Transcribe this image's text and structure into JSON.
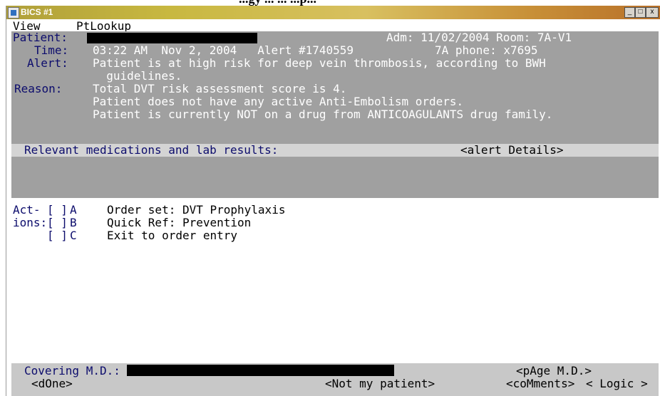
{
  "caption_fragment": "...gy ... ... ...p...",
  "window": {
    "title": "BICS #1",
    "min": "_",
    "restore": "□",
    "close": "x"
  },
  "menu": {
    "view": "View",
    "ptlookup": "PtLookup"
  },
  "patient": {
    "label": "Patient:",
    "adm": "Adm: 11/02/2004 Room: 7A-V1",
    "time_label": "Time:",
    "time_value": "03:22 AM  Nov 2, 2004   Alert #1740559",
    "phone": "7A phone: x7695"
  },
  "alert": {
    "label": "Alert:",
    "line1": "Patient is at high risk for deep vein thrombosis, according to BWH",
    "line2": "  guidelines."
  },
  "reason": {
    "label": "Reason:",
    "lines": [
      "Total DVT risk assessment score is 4.",
      "Patient does not have any active Anti-Embolism orders.",
      "Patient is currently NOT on a drug from ANTICOAGULANTS drug family."
    ]
  },
  "relevant": {
    "label": "Relevant medications and lab results:",
    "details": "<alert Details>"
  },
  "actions": {
    "label_line1": "Act-",
    "label_line2": "ions:",
    "items": [
      {
        "box": "[ ]",
        "key": "A",
        "text": "Order set: DVT Prophylaxis"
      },
      {
        "box": "[ ]",
        "key": "B",
        "text": "Quick Ref: Prevention"
      },
      {
        "box": "[ ]",
        "key": "C",
        "text": "Exit to order entry"
      }
    ]
  },
  "bottom": {
    "covering_label": "Covering M.D.:",
    "page_md": "<pAge M.D.>",
    "done": "<dOne>",
    "not_my_patient": "<Not my patient>",
    "comments": "<coMments>",
    "logic": "< Logic >"
  }
}
